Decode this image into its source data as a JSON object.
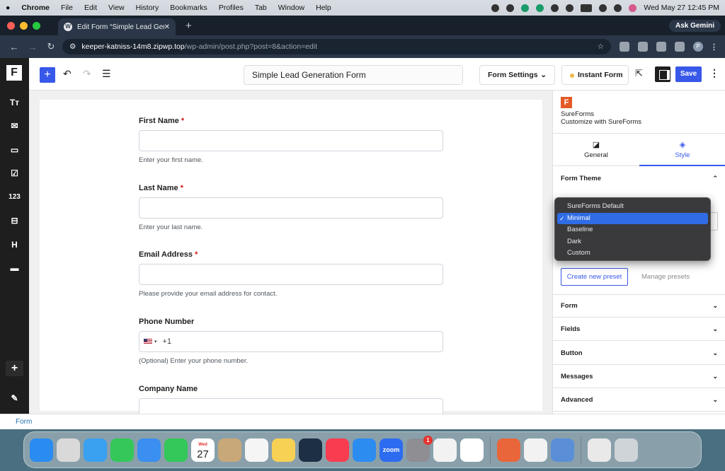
{
  "menubar": {
    "items": [
      "Chrome",
      "File",
      "Edit",
      "View",
      "History",
      "Bookmarks",
      "Profiles",
      "Tab",
      "Window",
      "Help"
    ],
    "datetime": "Wed May 27  12:45 PM"
  },
  "browser": {
    "tab_title": "Edit Form “Simple Lead Gene",
    "new_tab": "+",
    "ask_gemini": "Ask Gemini",
    "url_host": "keeper-katniss-14m8.zipwp.top",
    "url_path": "/wp-admin/post.php?post=8&action=edit",
    "profile_initial": "P"
  },
  "editor": {
    "left_tools": [
      {
        "name": "text-tool-icon",
        "glyph": "Tт"
      },
      {
        "name": "mail-icon",
        "glyph": "✉"
      },
      {
        "name": "textarea-icon",
        "glyph": "▭"
      },
      {
        "name": "checkbox-icon",
        "glyph": "☑"
      },
      {
        "name": "number-icon",
        "glyph": "123"
      },
      {
        "name": "dropdown-icon",
        "glyph": "⊟"
      },
      {
        "name": "heading-icon",
        "glyph": "H"
      },
      {
        "name": "payment-icon",
        "glyph": "▬"
      }
    ],
    "add_glyph": "+",
    "pen_glyph": "✎",
    "title": "Simple Lead Generation Form",
    "form_settings_label": "Form Settings",
    "instant_form_label": "Instant Form",
    "save_label": "Save"
  },
  "form": {
    "fields": [
      {
        "label": "First Name",
        "required": "*",
        "value": "",
        "help": "Enter your first name."
      },
      {
        "label": "Last Name",
        "required": "*",
        "value": "",
        "help": "Enter your last name."
      },
      {
        "label": "Email Address",
        "required": "*",
        "value": "",
        "help": "Please provide your email address for contact."
      },
      {
        "label": "Phone Number",
        "required": "",
        "value": "+1",
        "help": "(Optional) Enter your phone number."
      },
      {
        "label": "Company Name",
        "required": "",
        "value": "",
        "help": ""
      }
    ]
  },
  "sidebar": {
    "brand": "SureForms",
    "tagline": "Customize with SureForms",
    "tabs": [
      {
        "label": "General",
        "icon": "general-icon"
      },
      {
        "label": "Style",
        "icon": "paint-bucket-icon"
      }
    ],
    "form_theme_label": "Form Theme",
    "theme_options": [
      "SureForms Default",
      "Minimal",
      "Baseline",
      "Dark",
      "Custom"
    ],
    "selected_theme": "Minimal",
    "create_preset_label": "Create new preset",
    "manage_presets_label": "Manage presets",
    "panels": [
      "Form",
      "Fields",
      "Button",
      "Messages",
      "Advanced"
    ]
  },
  "statusbar": {
    "breadcrumb": "Form"
  },
  "dock": {
    "apps": [
      {
        "name": "finder",
        "color": "#2a8cf0"
      },
      {
        "name": "launchpad",
        "color": "#d9d9d9"
      },
      {
        "name": "safari",
        "color": "#3aa0f0"
      },
      {
        "name": "messages",
        "color": "#35c759"
      },
      {
        "name": "mail",
        "color": "#3a8ff0"
      },
      {
        "name": "facetime",
        "color": "#34c759"
      },
      {
        "name": "calendar",
        "color": "#ffffff"
      },
      {
        "name": "contacts",
        "color": "#c8a878"
      },
      {
        "name": "reminders",
        "color": "#f5f5f5"
      },
      {
        "name": "notes",
        "color": "#f7d154"
      },
      {
        "name": "freeform",
        "color": "#1c2f45"
      },
      {
        "name": "music",
        "color": "#fa3c50"
      },
      {
        "name": "app-store",
        "color": "#2d8cf0"
      },
      {
        "name": "zoom",
        "color": "#2d6cf0",
        "label": "zoom"
      },
      {
        "name": "system-settings",
        "color": "#8e8e93",
        "badge": "1"
      },
      {
        "name": "chrome",
        "color": "#f2f2f2"
      },
      {
        "name": "slack",
        "color": "#ffffff"
      },
      {
        "name": "claude",
        "color": "#e9663a"
      },
      {
        "name": "spreadsheet",
        "color": "#f2f2f2"
      },
      {
        "name": "jar-app",
        "color": "#5a8fd8"
      },
      {
        "name": "document",
        "color": "#e9e9e9"
      },
      {
        "name": "trash",
        "color": "#cfd4d8"
      }
    ],
    "calendar_month": "Wed",
    "calendar_day": "27"
  }
}
